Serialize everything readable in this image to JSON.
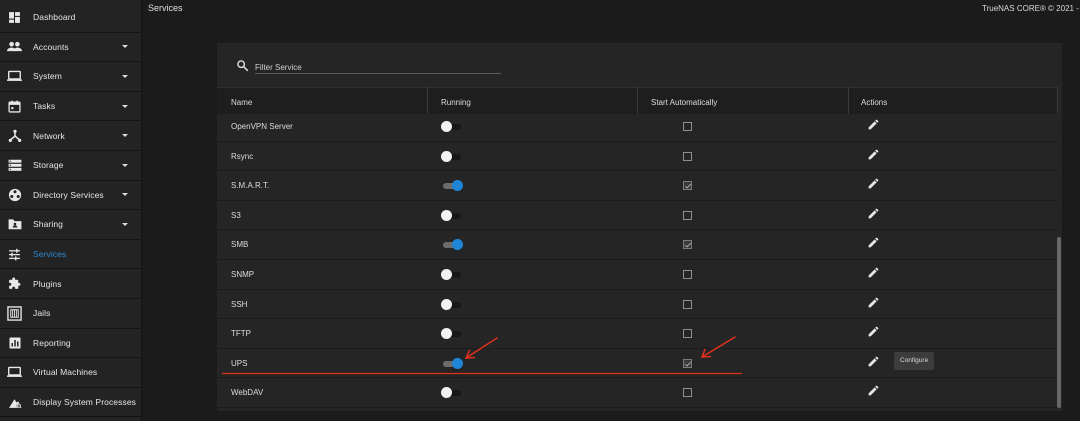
{
  "header": {
    "title": "Services",
    "brand": "TrueNAS CORE® © 2021 -"
  },
  "sidebar": {
    "items": [
      {
        "label": "Dashboard",
        "icon": "dashboard-icon",
        "caret": false,
        "active": false
      },
      {
        "label": "Accounts",
        "icon": "accounts-icon",
        "caret": true,
        "active": false
      },
      {
        "label": "System",
        "icon": "laptop-icon",
        "caret": true,
        "active": false
      },
      {
        "label": "Tasks",
        "icon": "calendar-icon",
        "caret": true,
        "active": false
      },
      {
        "label": "Network",
        "icon": "network-icon",
        "caret": true,
        "active": false
      },
      {
        "label": "Storage",
        "icon": "storage-icon",
        "caret": true,
        "active": false
      },
      {
        "label": "Directory Services",
        "icon": "directory-services-icon",
        "caret": true,
        "active": false
      },
      {
        "label": "Sharing",
        "icon": "folder-share-icon",
        "caret": true,
        "active": false
      },
      {
        "label": "Services",
        "icon": "tune-icon",
        "caret": false,
        "active": true
      },
      {
        "label": "Plugins",
        "icon": "puzzle-icon",
        "caret": false,
        "active": false
      },
      {
        "label": "Jails",
        "icon": "jail-icon",
        "caret": false,
        "active": false
      },
      {
        "label": "Reporting",
        "icon": "chart-icon",
        "caret": false,
        "active": false
      },
      {
        "label": "Virtual Machines",
        "icon": "laptop-icon",
        "caret": false,
        "active": false
      },
      {
        "label": "Display System Processes",
        "icon": "processes-icon",
        "caret": false,
        "active": false
      }
    ]
  },
  "search": {
    "placeholder": "Filter Service",
    "value": ""
  },
  "table": {
    "headers": {
      "name": "Name",
      "running": "Running",
      "start_automatically": "Start Automatically",
      "actions": "Actions"
    },
    "rows": [
      {
        "name": "OpenVPN Server",
        "running": false,
        "start_automatically": false
      },
      {
        "name": "Rsync",
        "running": false,
        "start_automatically": false
      },
      {
        "name": "S.M.A.R.T.",
        "running": true,
        "start_automatically": true
      },
      {
        "name": "S3",
        "running": false,
        "start_automatically": false
      },
      {
        "name": "SMB",
        "running": true,
        "start_automatically": true
      },
      {
        "name": "SNMP",
        "running": false,
        "start_automatically": false
      },
      {
        "name": "SSH",
        "running": false,
        "start_automatically": false
      },
      {
        "name": "TFTP",
        "running": false,
        "start_automatically": false
      },
      {
        "name": "UPS",
        "running": true,
        "start_automatically": true
      },
      {
        "name": "WebDAV",
        "running": false,
        "start_automatically": false
      }
    ]
  },
  "tooltip": {
    "text": "Configure"
  },
  "colors": {
    "accent": "#1f86d7",
    "active_nav": "#2b8bd8",
    "annotation": "#e0301e"
  }
}
